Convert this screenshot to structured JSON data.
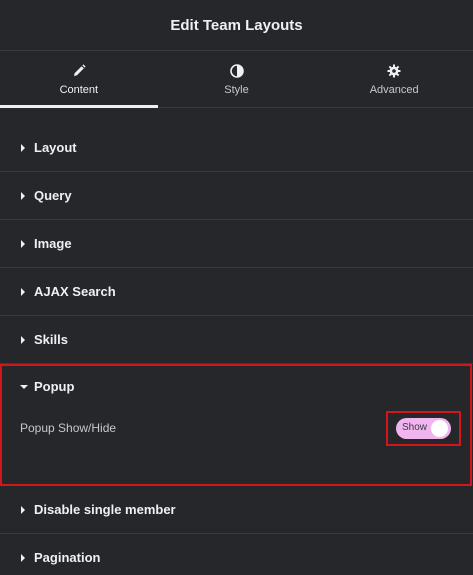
{
  "header": {
    "title": "Edit Team Layouts"
  },
  "tabs": [
    {
      "label": "Content",
      "icon": "pencil-icon",
      "active": true
    },
    {
      "label": "Style",
      "icon": "half-circle-icon",
      "active": false
    },
    {
      "label": "Advanced",
      "icon": "gear-icon",
      "active": false
    }
  ],
  "sections": {
    "layout": "Layout",
    "query": "Query",
    "image": "Image",
    "ajax_search": "AJAX Search",
    "skills": "Skills",
    "popup": "Popup",
    "disable_single_member": "Disable single member",
    "pagination": "Pagination"
  },
  "popup": {
    "control_label": "Popup Show/Hide",
    "toggle_text": "Show",
    "toggle_on": true
  },
  "colors": {
    "highlight": "#d3161b",
    "toggle_on": "#f0b5ef",
    "background": "#26272b"
  }
}
